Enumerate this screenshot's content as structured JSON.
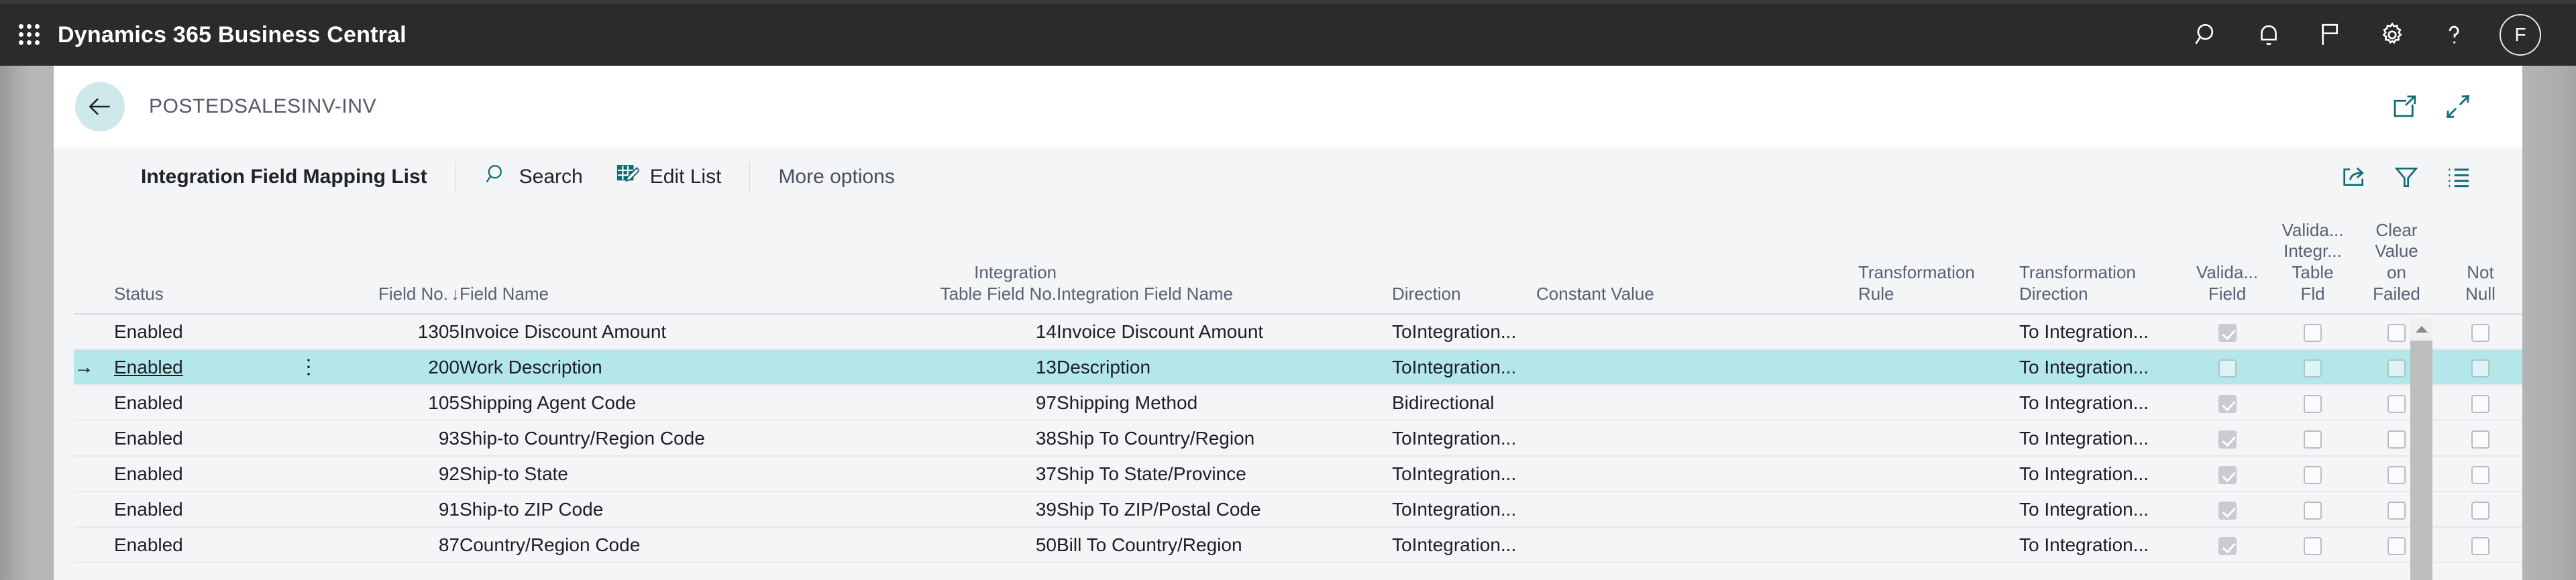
{
  "topbar": {
    "app_title": "Dynamics 365 Business Central",
    "waffle_name": "app-launcher-icon",
    "icons": [
      {
        "name": "search-icon",
        "label": "Search"
      },
      {
        "name": "bell-icon",
        "label": "Notifications"
      },
      {
        "name": "flag-icon",
        "label": "Bookmarks"
      },
      {
        "name": "gear-icon",
        "label": "Settings"
      },
      {
        "name": "help-icon",
        "label": "Help"
      }
    ],
    "avatar_initial": "F",
    "background": "#2b2b2b"
  },
  "page_header": {
    "back_label": "Back",
    "breadcrumb": "POSTEDSALESINV-INV",
    "icons": [
      {
        "name": "open-in-new-window-icon",
        "label": "Open in new window"
      },
      {
        "name": "collapse-icon",
        "label": "Collapse"
      }
    ],
    "accent": "#cfe8e9"
  },
  "actionbar": {
    "caption": "Integration Field Mapping List",
    "search_label": "Search",
    "edit_list_label": "Edit List",
    "more_options_label": "More options",
    "icons": [
      {
        "name": "share-icon",
        "label": "Share"
      },
      {
        "name": "filter-icon",
        "label": "Filter"
      },
      {
        "name": "list-options-icon",
        "label": "Choose columns"
      }
    ]
  },
  "grid": {
    "sort_column": "Field No.",
    "sort_direction": "descending",
    "columns": [
      {
        "key": "status",
        "label": "Status",
        "align": "left"
      },
      {
        "key": "fieldno",
        "label": "Field No.",
        "align": "right"
      },
      {
        "key": "fieldname",
        "label": "Field Name",
        "align": "left"
      },
      {
        "key": "itfno",
        "label": "Integration\nTable Field No.",
        "align": "right"
      },
      {
        "key": "ifname",
        "label": "Integration Field Name",
        "align": "left"
      },
      {
        "key": "dir",
        "label": "Direction",
        "align": "left"
      },
      {
        "key": "const",
        "label": "Constant Value",
        "align": "left"
      },
      {
        "key": "trule",
        "label": "Transformation\nRule",
        "align": "left"
      },
      {
        "key": "tdir",
        "label": "Transformation\nDirection",
        "align": "left"
      },
      {
        "key": "vfield",
        "label": "Valida...\nField",
        "align": "center"
      },
      {
        "key": "vitf",
        "label": "Valida...\nIntegr...\nTable\nFld",
        "align": "center"
      },
      {
        "key": "clear",
        "label": "Clear\nValue\non\nFailed",
        "align": "center"
      },
      {
        "key": "notnull",
        "label": "Not\nNull",
        "align": "center"
      }
    ],
    "header_lines": {
      "status": [
        "",
        "",
        "",
        "Status"
      ],
      "fieldno": [
        "",
        "",
        "",
        "Field No."
      ],
      "fieldname": [
        "",
        "",
        "",
        "Field Name"
      ],
      "itfno": [
        "",
        "",
        "Integration",
        "Table Field No."
      ],
      "ifname": [
        "",
        "",
        "",
        "Integration Field Name"
      ],
      "dir": [
        "",
        "",
        "",
        "Direction"
      ],
      "const": [
        "",
        "",
        "",
        "Constant Value"
      ],
      "trule": [
        "",
        "",
        "Transformation",
        "Rule"
      ],
      "tdir": [
        "",
        "",
        "Transformation",
        "Direction"
      ],
      "vfield": [
        "",
        "",
        "Valida...",
        "Field"
      ],
      "vitf": [
        "Valida...",
        "Integr...",
        "Table",
        "Fld"
      ],
      "clear": [
        "Clear",
        "Value",
        "on",
        "Failed"
      ],
      "notnull": [
        "",
        "",
        "Not",
        "Null"
      ]
    },
    "sort_arrow_glyph": "↓",
    "row_pointer_glyph": "→",
    "row_menu_glyph": "⋮",
    "selected_index": 1,
    "rows": [
      {
        "status": "Enabled",
        "fieldno": "1305",
        "fieldname": "Invoice Discount Amount",
        "itfno": "14",
        "ifname": "Invoice Discount Amount",
        "dir": "ToIntegration...",
        "const": "",
        "trule": "",
        "tdir": "To Integration...",
        "vfield": true,
        "vitf": false,
        "clear": false,
        "notnull": false
      },
      {
        "status": "Enabled",
        "fieldno": "200",
        "fieldname": "Work Description",
        "itfno": "13",
        "ifname": "Description",
        "dir": "ToIntegration...",
        "const": "",
        "trule": "",
        "tdir": "To Integration...",
        "vfield": false,
        "vitf": false,
        "clear": false,
        "notnull": false
      },
      {
        "status": "Enabled",
        "fieldno": "105",
        "fieldname": "Shipping Agent Code",
        "itfno": "97",
        "ifname": "Shipping Method",
        "dir": "Bidirectional",
        "const": "",
        "trule": "",
        "tdir": "To Integration...",
        "vfield": true,
        "vitf": false,
        "clear": false,
        "notnull": false
      },
      {
        "status": "Enabled",
        "fieldno": "93",
        "fieldname": "Ship-to Country/Region Code",
        "itfno": "38",
        "ifname": "Ship To Country/Region",
        "dir": "ToIntegration...",
        "const": "",
        "trule": "",
        "tdir": "To Integration...",
        "vfield": true,
        "vitf": false,
        "clear": false,
        "notnull": false
      },
      {
        "status": "Enabled",
        "fieldno": "92",
        "fieldname": "Ship-to State",
        "itfno": "37",
        "ifname": "Ship To State/Province",
        "dir": "ToIntegration...",
        "const": "",
        "trule": "",
        "tdir": "To Integration...",
        "vfield": true,
        "vitf": false,
        "clear": false,
        "notnull": false
      },
      {
        "status": "Enabled",
        "fieldno": "91",
        "fieldname": "Ship-to ZIP Code",
        "itfno": "39",
        "ifname": "Ship To ZIP/Postal Code",
        "dir": "ToIntegration...",
        "const": "",
        "trule": "",
        "tdir": "To Integration...",
        "vfield": true,
        "vitf": false,
        "clear": false,
        "notnull": false
      },
      {
        "status": "Enabled",
        "fieldno": "87",
        "fieldname": "Country/Region Code",
        "itfno": "50",
        "ifname": "Bill To Country/Region",
        "dir": "ToIntegration...",
        "const": "",
        "trule": "",
        "tdir": "To Integration...",
        "vfield": true,
        "vitf": false,
        "clear": false,
        "notnull": false
      }
    ]
  },
  "scrollbar": {
    "name": "vertical-scrollbar",
    "up_arrow": "▲"
  },
  "colors": {
    "accent_teal": "#0f6c72",
    "selection": "#b3e7ea",
    "grid_bg": "#f4f5f7",
    "header_text": "#5a5f73"
  }
}
